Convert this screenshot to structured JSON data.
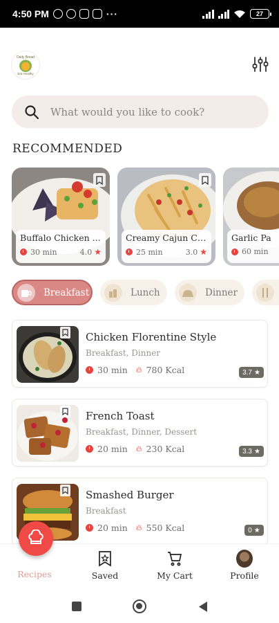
{
  "status_bar": {
    "time": "4:50 PM",
    "more": "···",
    "battery": "27"
  },
  "logo": {
    "top_text": "Daily Bread",
    "bottom_text": "Eat Healthy"
  },
  "search": {
    "placeholder": "What would you like to cook?"
  },
  "section_title": "RECOMMENDED",
  "recommended": [
    {
      "name": "Buffalo Chicken ...",
      "time": "30 min",
      "rating": "4.0"
    },
    {
      "name": "Creamy Cajun Ch...",
      "time": "25 min",
      "rating": "3.0"
    },
    {
      "name": "Garlic Pa",
      "time": "60 min",
      "rating": ""
    }
  ],
  "categories": [
    {
      "label": "Breakfast",
      "active": true
    },
    {
      "label": "Lunch",
      "active": false
    },
    {
      "label": "Dinner",
      "active": false
    },
    {
      "label": "",
      "active": false
    }
  ],
  "recipes": [
    {
      "title": "Chicken Florentine Style",
      "tags": "Breakfast, Dinner",
      "time": "30 min",
      "kcal": "780 Kcal",
      "rating": "3.7"
    },
    {
      "title": "French Toast",
      "tags": "Breakfast, Dinner, Dessert",
      "time": "20 min",
      "kcal": "230 Kcal",
      "rating": "3.3"
    },
    {
      "title": "Smashed Burger",
      "tags": "Breakfast",
      "time": "20 min",
      "kcal": "550 Kcal",
      "rating": "0"
    }
  ],
  "bottom_nav": [
    {
      "label": "Recipes",
      "icon": "chef-hat-icon",
      "active": true
    },
    {
      "label": "Saved",
      "icon": "bookmark-icon",
      "active": false
    },
    {
      "label": "My Cart",
      "icon": "cart-icon",
      "active": false
    },
    {
      "label": "Profile",
      "icon": "avatar",
      "active": false
    }
  ],
  "colors": {
    "accent": "#ef4a46",
    "chip_active": "#d98886",
    "badge": "#6b6b61",
    "search_bg": "#f3ece8"
  }
}
